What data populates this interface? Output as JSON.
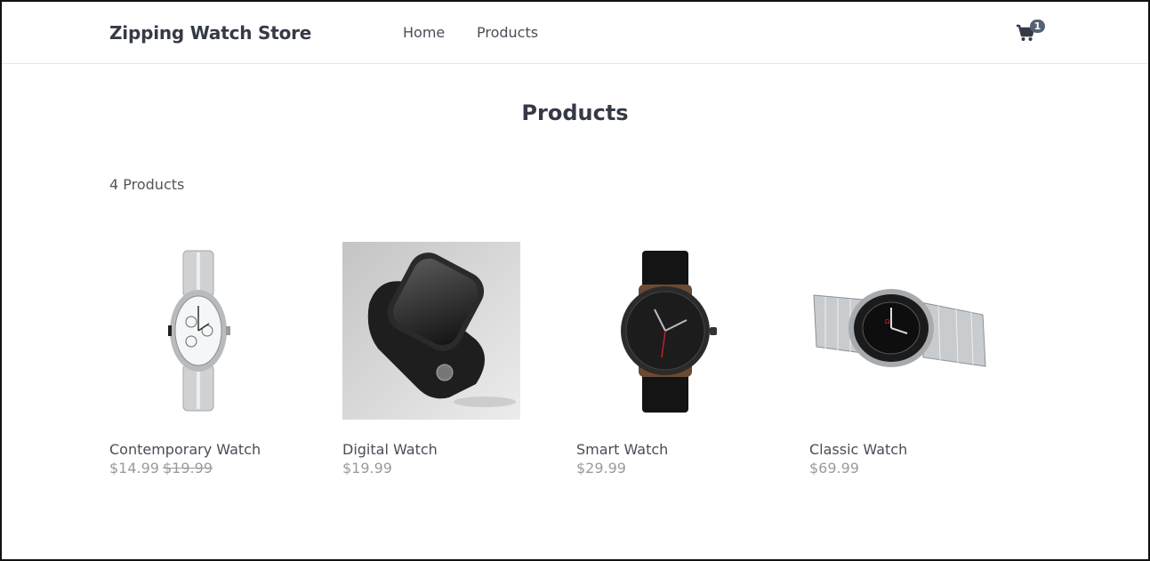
{
  "header": {
    "brand": "Zipping Watch Store",
    "nav": {
      "home": "Home",
      "products": "Products"
    },
    "cart": {
      "icon": "cart-icon",
      "count": "1"
    }
  },
  "main": {
    "title": "Products",
    "count_label": "4 Products",
    "products": [
      {
        "name": "Contemporary Watch",
        "price": "$14.99",
        "old_price": "$19.99",
        "image": "silver-chronograph-watch"
      },
      {
        "name": "Digital Watch",
        "price": "$19.99",
        "old_price": "",
        "image": "black-smartwatch-photo"
      },
      {
        "name": "Smart Watch",
        "price": "$29.99",
        "old_price": "",
        "image": "black-leather-strap-watch"
      },
      {
        "name": "Classic Watch",
        "price": "$69.99",
        "old_price": "",
        "image": "steel-diver-watch"
      }
    ]
  },
  "colors": {
    "text_dark": "#363a46",
    "price_gray": "#9b9b9b",
    "badge": "#556275",
    "border": "#e7e7e7"
  }
}
